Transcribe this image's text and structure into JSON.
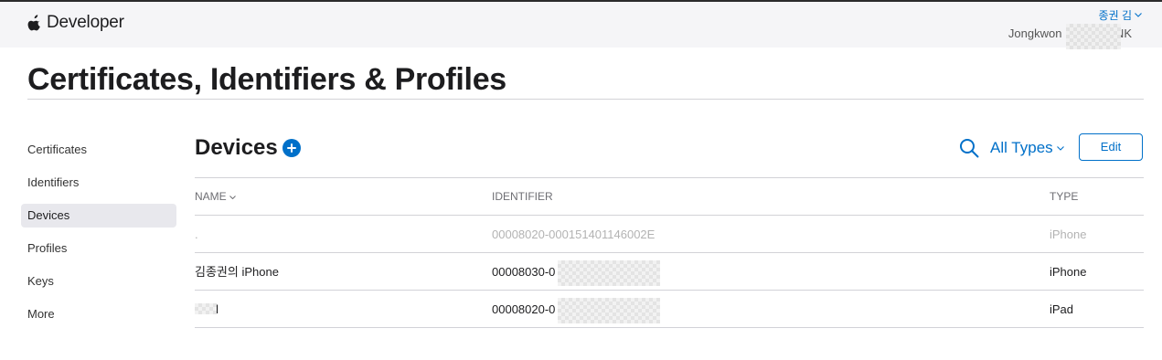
{
  "header": {
    "brand": "Developer",
    "user_name": "종권 김",
    "team_name": "Jongkwon Kim - SS      NK"
  },
  "page": {
    "title": "Certificates, Identifiers & Profiles"
  },
  "sidebar": {
    "items": [
      {
        "label": "Certificates"
      },
      {
        "label": "Identifiers"
      },
      {
        "label": "Devices"
      },
      {
        "label": "Profiles"
      },
      {
        "label": "Keys"
      },
      {
        "label": "More"
      }
    ]
  },
  "main": {
    "title": "Devices",
    "filter_label": "All Types",
    "edit_label": "Edit",
    "columns": [
      "NAME",
      "IDENTIFIER",
      "TYPE"
    ],
    "rows": [
      {
        "name": ".",
        "identifier": "00008020-000151401146002E",
        "type": "iPhone",
        "disabled": true
      },
      {
        "name": "김종권의 iPhone",
        "identifier": "00008030-0                    2E",
        "type": "iPhone",
        "disabled": false
      },
      {
        "name": "      iPad",
        "identifier": "00008020-0                    E",
        "type": "iPad",
        "disabled": false
      }
    ]
  },
  "colors": {
    "accent": "#0070c9",
    "topbar": "#f5f5f7",
    "sidebar_active": "#e8e8ed"
  },
  "icons": {
    "brand": "apple-logo-icon",
    "add": "plus-circle-icon",
    "search": "search-icon",
    "chevron": "chevron-down-icon"
  }
}
